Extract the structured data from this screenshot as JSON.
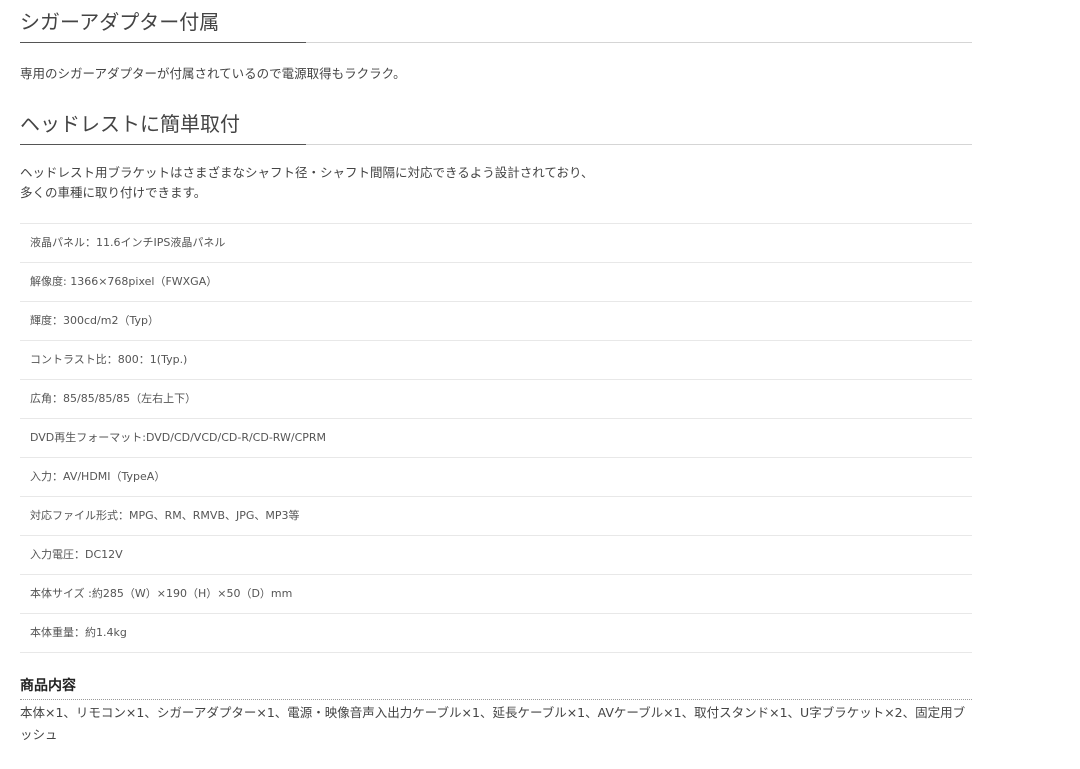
{
  "sections": [
    {
      "heading": "シガーアダプター付属",
      "text": "専用のシガーアダプターが付属されているので電源取得もラクラク。"
    },
    {
      "heading": "ヘッドレストに簡単取付",
      "text": "ヘッドレスト用ブラケットはさまざまなシャフト径・シャフト間隔に対応できるよう設計されており、",
      "text2": "多くの車種に取り付けできます。"
    }
  ],
  "specs": [
    "液晶パネル：11.6インチIPS液晶パネル",
    "解像度: 1366×768pixel（FWXGA）",
    "輝度：300cd/m2（Typ）",
    "コントラスト比：800：1(Typ.)",
    "広角：85/85/85/85（左右上下）",
    "DVD再生フォーマット:DVD/CD/VCD/CD-R/CD-RW/CPRM",
    "入力：AV/HDMI（TypeA）",
    "対応ファイル形式：MPG、RM、RMVB、JPG、MP3等",
    "入力電圧：DC12V",
    "本体サイズ :約285（W）×190（H）×50（D）mm",
    "本体重量：約1.4kg"
  ],
  "package": {
    "heading": "商品内容",
    "text": "本体×1、リモコン×1、シガーアダプター×1、電源・映像音声入出力ケーブル×1、延長ケーブル×1、AVケーブル×1、取付スタンド×1、U字ブラケット×2、固定用ブッシュ"
  }
}
